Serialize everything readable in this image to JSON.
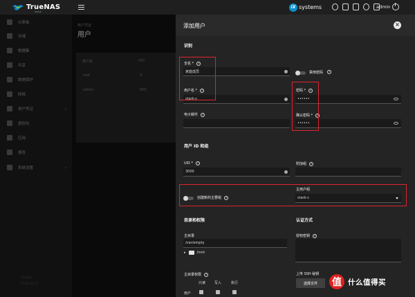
{
  "app": {
    "name": "TrueNAS",
    "edition": "SCALE",
    "menu_icon": "hamburger-icon"
  },
  "topbar": {
    "brand": "systems",
    "brand_badge": "iX",
    "user": "admin",
    "icons": [
      "truecommand-icon",
      "jobs-icon",
      "clipboard-icon",
      "settings-icon",
      "notifications-icon"
    ]
  },
  "sidebar": {
    "items": [
      {
        "label": "仪表板",
        "icon": "dashboard-icon"
      },
      {
        "label": "存储",
        "icon": "storage-icon"
      },
      {
        "label": "数据集",
        "icon": "datasets-icon"
      },
      {
        "label": "共享",
        "icon": "shares-icon"
      },
      {
        "label": "数据保护",
        "icon": "data-protection-icon"
      },
      {
        "label": "网络",
        "icon": "network-icon"
      },
      {
        "label": "用户凭证",
        "icon": "credentials-icon",
        "active": true
      },
      {
        "label": "虚拟化",
        "icon": "virtualization-icon"
      },
      {
        "label": "应用",
        "icon": "apps-icon"
      },
      {
        "label": "报告",
        "icon": "reports-icon"
      },
      {
        "label": "系统设置",
        "icon": "system-settings-icon"
      }
    ],
    "footer": [
      "TrueNAS",
      "SCALE 22.12"
    ]
  },
  "main": {
    "breadcrumb": "用户凭证",
    "title": "用户",
    "table": {
      "headers": [
        "用户名",
        "UID"
      ],
      "rows": [
        [
          "root",
          "0"
        ],
        [
          "admin",
          "950"
        ]
      ]
    }
  },
  "dialog": {
    "title": "添加用户",
    "close_icon": "close-icon",
    "section_identification": "识别",
    "full_name": {
      "label": "全名 *",
      "value": "家庭成员"
    },
    "disable_password": {
      "label": "禁用密码"
    },
    "username": {
      "label": "用户名 *",
      "value": "stark-c"
    },
    "password": {
      "label": "密码 *",
      "value": "••••••"
    },
    "email": {
      "label": "电子邮件"
    },
    "confirm_password": {
      "label": "确认密码 *",
      "value": "••••••"
    },
    "section_uid": "用户 ID 和组",
    "uid": {
      "label": "UID *",
      "value": "3000"
    },
    "aux_groups": {
      "label": "附加组"
    },
    "create_primary_group": {
      "label": "创建新的主要组"
    },
    "primary_group": {
      "label": "主用户组",
      "value": "stark-c"
    },
    "section_dirs": "目录和权限",
    "section_auth": "认证方式",
    "home_dir": {
      "label": "主目录",
      "value": "/var/empty",
      "tree_item": "/mnt"
    },
    "auth_keys": {
      "label": "授权密钥"
    },
    "home_perms": {
      "label": "主目录权限",
      "cols": [
        "只读",
        "写入",
        "执行"
      ],
      "row_label": "用户"
    },
    "ssh_key": {
      "label": "上传 SSH 秘钥",
      "button": "选择文件"
    }
  },
  "watermark": {
    "badge": "值",
    "text": "什么值得买"
  },
  "colors": {
    "highlight": "#e0232d",
    "accent": "#0b8fd0"
  }
}
